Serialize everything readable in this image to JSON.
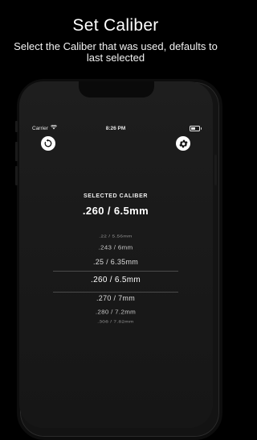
{
  "header": {
    "title": "Set Caliber",
    "subtitle": "Select the Caliber that was used, defaults to last selected"
  },
  "status_bar": {
    "carrier": "Carrier",
    "time": "8:26 PM"
  },
  "icons": {
    "reset": "reset-icon",
    "settings": "gear-icon",
    "wifi": "wifi-icon",
    "battery": "battery-icon"
  },
  "selection": {
    "label": "SELECTED CALIBER",
    "value": ".260 / 6.5mm"
  },
  "picker": {
    "items": [
      "",
      ".22 / 5.56mm",
      ".243 / 6mm",
      ".25 / 6.35mm",
      ".260 / 6.5mm",
      ".270 / 7mm",
      ".280 / 7.2mm",
      ".308 / 7.82mm",
      ""
    ],
    "selected": ".260 / 6.5mm"
  },
  "colors": {
    "background": "#000000",
    "phone_screen": "#1a1a1a",
    "text": "#ffffff",
    "divider": "#4a4a4a"
  }
}
